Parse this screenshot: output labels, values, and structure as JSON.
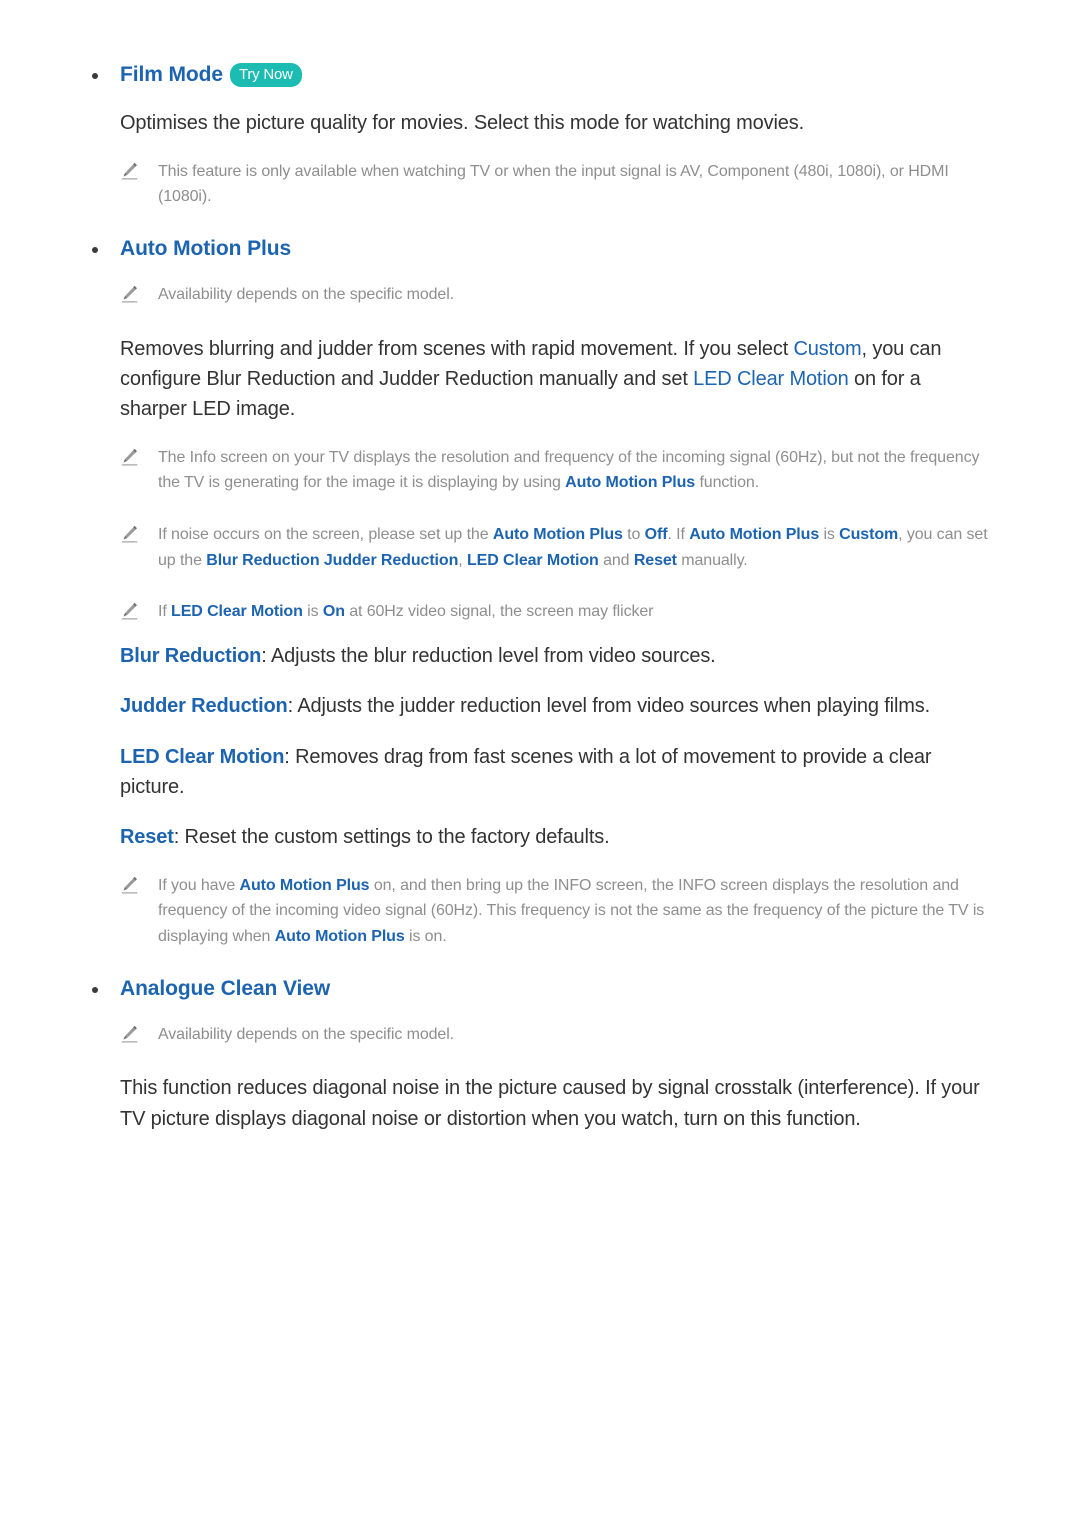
{
  "document": {
    "colors": {
      "heading_blue": "#1d64b0",
      "term_blue": "#1d64b0",
      "badge_teal": "#1cbcb2",
      "body_text": "#333333",
      "note_text": "#8e8e8e",
      "bullet_dot": "#3a3a3a",
      "page_background": "#ffffff"
    },
    "sections": [
      {
        "id": "film-mode",
        "heading": "Film Mode",
        "badge": "Try Now",
        "body": "Optimises the picture quality for movies. Select this mode for watching movies.",
        "note": "This feature is only available when watching TV or when the input signal is AV, Component (480i, 1080i), or HDMI (1080i)."
      },
      {
        "id": "auto-motion-plus",
        "heading": "Auto Motion Plus",
        "note_availability": "Availability depends on the specific model.",
        "body_1": "Removes blurring and judder from scenes with rapid movement. If you select ",
        "body_1_term_1": "Custom",
        "body_1_mid": ", you can configure Blur Reduction and Judder Reduction manually and set ",
        "body_1_term_2": "LED Clear Motion",
        "body_1_end": " on for a sharper LED image.",
        "note_info_a": "The Info screen on your TV displays the resolution and frequency of the incoming signal (60Hz), but not the frequency the TV is generating for the image it is displaying by using ",
        "note_info_term": "Auto Motion Plus",
        "note_info_b": " function.",
        "note_noise_a": "If noise occurs on the screen, please set up the ",
        "note_noise_t1": "Auto Motion Plus",
        "note_noise_b": " to ",
        "note_noise_t2": "Off",
        "note_noise_c": ". If ",
        "note_noise_t3": "Auto Motion Plus",
        "note_noise_d": " is ",
        "note_noise_t4": "Custom",
        "note_noise_e": ", you can set up the ",
        "note_noise_t5": "Blur Reduction Judder Reduction",
        "note_noise_f": ", ",
        "note_noise_t6": "LED Clear Motion",
        "note_noise_g": " and ",
        "note_noise_t7": "Reset",
        "note_noise_h": " manually.",
        "note_flicker_a": "If ",
        "note_flicker_t1": "LED Clear Motion",
        "note_flicker_b": " is ",
        "note_flicker_t2": "On",
        "note_flicker_c": " at 60Hz video signal, the screen may flicker",
        "items": [
          {
            "label": "Blur Reduction",
            "description": ": Adjusts the blur reduction level from video sources."
          },
          {
            "label": "Judder Reduction",
            "description": ": Adjusts the judder reduction level from video sources when playing films."
          },
          {
            "label": "LED Clear Motion",
            "description": ": Removes drag from fast scenes with a lot of movement to provide a clear picture."
          },
          {
            "label": "Reset",
            "description": ": Reset the custom settings to the factory defaults."
          }
        ],
        "note_info2_a": "If you have ",
        "note_info2_t1": "Auto Motion Plus",
        "note_info2_b": " on, and then bring up the INFO screen, the INFO screen displays the resolution and frequency of the incoming video signal (60Hz). This frequency is not the same as the frequency of the picture the TV is displaying when ",
        "note_info2_t2": "Auto Motion Plus",
        "note_info2_c": " is on."
      },
      {
        "id": "analogue-clean-view",
        "heading": "Analogue Clean View",
        "note_availability": "Availability depends on the specific model.",
        "body": "This function reduces diagonal noise in the picture caused by signal crosstalk (interference). If your TV picture displays diagonal noise or distortion when you watch, turn on this function."
      }
    ]
  }
}
